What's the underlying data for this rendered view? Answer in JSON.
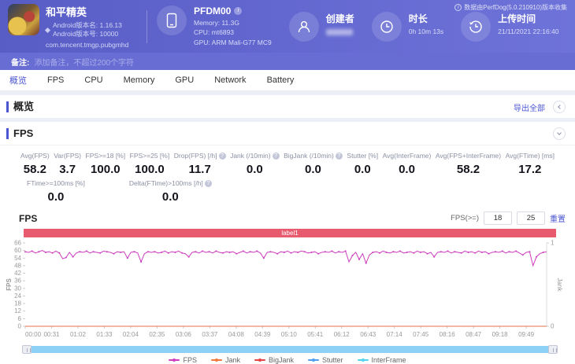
{
  "header": {
    "game": {
      "title": "和平精英",
      "version_name": "Android版本名: 1.16.13",
      "version_code": "Android版本号: 10000",
      "package": "com.tencent.tmgp.pubgmhd"
    },
    "device": {
      "name": "PFDM00",
      "memory": "Memory: 11.3G",
      "cpu": "CPU: mt6893",
      "gpu": "GPU: ARM Mali-G77 MC9"
    },
    "creator": {
      "label": "创建者"
    },
    "duration": {
      "label": "时长",
      "value": "0h 10m 13s"
    },
    "upload": {
      "label": "上传时间",
      "value": "21/11/2021 22:16:40"
    },
    "source_note": "数据由PerfDog(5.0.210910)版本收集"
  },
  "note_bar": {
    "label": "备注:",
    "placeholder": "添加备注，不超过200个字符"
  },
  "tabs": [
    {
      "label": "概览"
    },
    {
      "label": "FPS"
    },
    {
      "label": "CPU"
    },
    {
      "label": "Memory"
    },
    {
      "label": "GPU"
    },
    {
      "label": "Network"
    },
    {
      "label": "Battery"
    }
  ],
  "overview": {
    "title": "概览",
    "export_label": "导出全部"
  },
  "fps_section": {
    "title": "FPS",
    "metrics_row1": [
      {
        "label": "Avg(FPS)",
        "value": "58.2"
      },
      {
        "label": "Var(FPS)",
        "value": "3.7"
      },
      {
        "label": "FPS>=18 [%]",
        "value": "100.0"
      },
      {
        "label": "FPS>=25 [%]",
        "value": "100.0"
      },
      {
        "label": "Drop(FPS) [/h]",
        "value": "11.7"
      },
      {
        "label": "Jank (/10min)",
        "value": "0.0"
      },
      {
        "label": "BigJank (/10min)",
        "value": "0.0"
      },
      {
        "label": "Stutter [%]",
        "value": "0.0"
      },
      {
        "label": "Avg(InterFrame)",
        "value": "0.0"
      },
      {
        "label": "Avg(FPS+InterFrame)",
        "value": "58.2"
      },
      {
        "label": "Avg(FTime) [ms]",
        "value": "17.2"
      }
    ],
    "metrics_row2": [
      {
        "label": "FTime>=100ms [%]",
        "value": "0.0"
      },
      {
        "label": "Delta(FTime)>100ms [/h]",
        "value": "0.0"
      }
    ],
    "chart_title": "FPS",
    "threshold_label": "FPS(>=)",
    "threshold1": "18",
    "threshold2": "25",
    "reset_label": "重置"
  },
  "chart_data": {
    "type": "line",
    "title": "FPS",
    "annotation_band": {
      "label": "label1",
      "color": "#e85a6e"
    },
    "ylabel_left": "FPS",
    "ylabel_right": "Jank",
    "ylim_left": [
      0,
      66
    ],
    "yticks_left": [
      0,
      6,
      12,
      18,
      24,
      30,
      36,
      42,
      48,
      54,
      60,
      66
    ],
    "ylim_right": [
      0,
      1
    ],
    "yticks_right": [
      0,
      1
    ],
    "grid": false,
    "legend_position": "bottom",
    "xticks": [
      "00:00",
      "00:31",
      "01:02",
      "01:33",
      "02:04",
      "02:35",
      "03:06",
      "03:37",
      "04:08",
      "04:39",
      "05:10",
      "05:41",
      "06:12",
      "06:43",
      "07:14",
      "07:45",
      "08:16",
      "08:47",
      "09:18",
      "09:49"
    ],
    "x_tick_interval_s": 31,
    "x_total_s": 613,
    "series": [
      {
        "name": "FPS",
        "color": "#cc3fbe",
        "values": [
          59,
          58.5,
          59.5,
          58,
          59,
          60,
          58.5,
          59,
          58,
          59.5,
          58,
          53.5,
          54.5,
          58.5,
          55,
          58,
          59,
          58.5,
          59.5,
          58,
          59,
          58.5,
          58,
          59.5,
          59,
          58.5,
          57.5,
          59,
          58.5,
          59,
          54,
          58.5,
          59,
          58,
          51,
          57.5,
          59,
          58.5,
          59,
          58,
          58.5,
          59.5,
          58,
          59,
          58.5,
          59.5,
          58,
          57.5,
          55,
          58.5,
          59,
          58,
          59.5,
          58.5,
          59,
          58,
          59.5,
          58.5,
          58,
          59,
          58.5,
          59,
          57.5,
          58.5,
          59.5,
          58,
          59,
          58.5,
          59.5,
          58,
          54,
          58.5,
          59,
          58.5,
          57.5,
          59,
          58.5,
          59.5,
          58,
          59,
          58.5,
          59.5,
          59,
          58,
          58.5,
          59,
          57.5,
          58.5,
          59,
          58.5,
          59.5,
          58,
          59,
          58.5,
          59.5,
          51,
          56,
          58.5,
          53,
          57.5,
          50,
          56.5,
          58.5,
          59,
          58,
          59.5,
          58.5,
          58,
          59,
          58.5,
          59.5,
          58,
          58.5,
          59,
          58,
          59.5,
          58.5,
          59,
          57.5,
          58.5,
          55,
          58.5,
          59,
          58.5,
          59.5,
          58,
          59,
          58.5,
          58,
          59.5,
          58.5,
          59,
          58,
          59.5,
          58.5,
          59,
          57.5,
          58.5,
          59,
          58.5,
          59.5,
          58,
          59,
          58.5,
          59.5,
          58,
          56.5,
          58.5,
          59,
          48,
          55,
          57.5,
          58.5,
          59
        ]
      },
      {
        "name": "Jank",
        "color": "#f07840",
        "constant": 0
      },
      {
        "name": "BigJank",
        "color": "#e54545",
        "constant": 0
      },
      {
        "name": "Stutter",
        "color": "#4f9ef0",
        "constant": 0
      },
      {
        "name": "InterFrame",
        "color": "#53d2f0",
        "constant": 0
      }
    ]
  }
}
